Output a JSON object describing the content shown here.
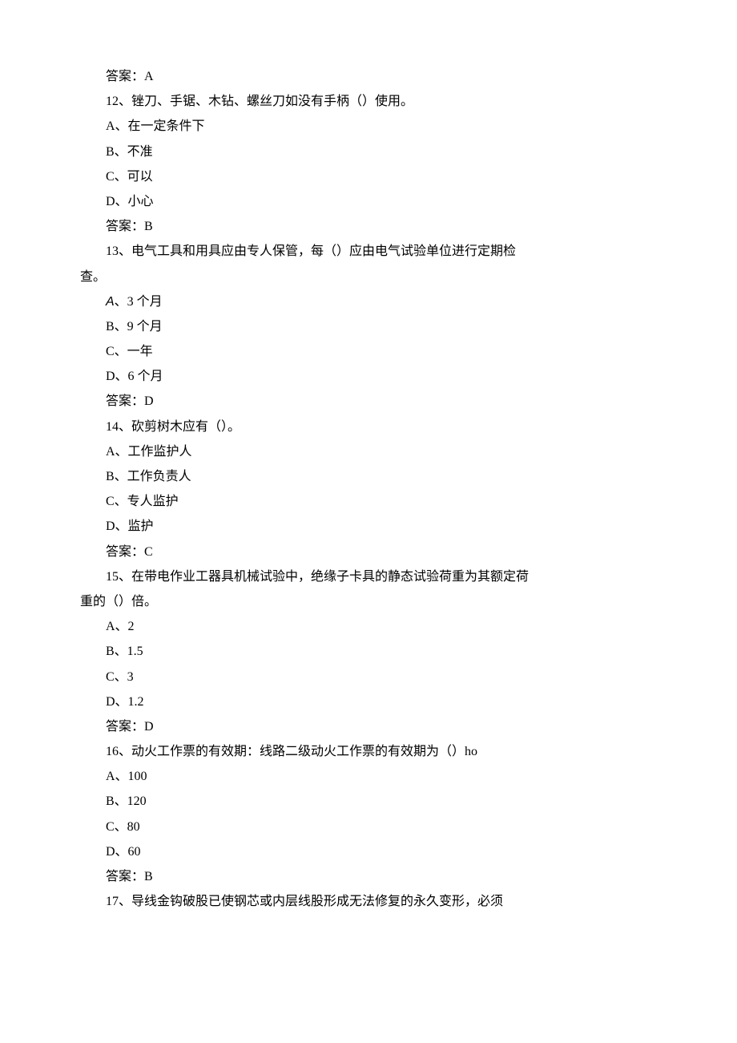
{
  "lines": [
    {
      "indent": true,
      "text": "答案：A"
    },
    {
      "indent": true,
      "text": "12、锉刀、手锯、木钻、螺丝刀如没有手柄（）使用。"
    },
    {
      "indent": true,
      "text": "A、在一定条件下"
    },
    {
      "indent": true,
      "text": "B、不准"
    },
    {
      "indent": true,
      "text": "C、可以"
    },
    {
      "indent": true,
      "text": "D、小心"
    },
    {
      "indent": true,
      "text": "答案：B"
    },
    {
      "indent": true,
      "text": "13、电气工具和用具应由专人保管，每（）应由电气试验单位进行定期检"
    },
    {
      "indent": false,
      "text": "查。"
    },
    {
      "indent": true,
      "italicA": true,
      "text": "、3 个月"
    },
    {
      "indent": true,
      "text": "B、9 个月"
    },
    {
      "indent": true,
      "text": "C、一年"
    },
    {
      "indent": true,
      "text": "D、6 个月"
    },
    {
      "indent": true,
      "text": "答案：D"
    },
    {
      "indent": true,
      "text": "14、砍剪树木应有（）。"
    },
    {
      "indent": true,
      "text": "A、工作监护人"
    },
    {
      "indent": true,
      "text": "B、工作负责人"
    },
    {
      "indent": true,
      "text": "C、专人监护"
    },
    {
      "indent": true,
      "text": "D、监护"
    },
    {
      "indent": true,
      "text": "答案：C"
    },
    {
      "indent": true,
      "text": "15、在带电作业工器具机械试验中，绝缘子卡具的静态试验荷重为其额定荷"
    },
    {
      "indent": false,
      "text": "重的（）倍。"
    },
    {
      "indent": true,
      "text": "A、2"
    },
    {
      "indent": true,
      "text": "B、1.5"
    },
    {
      "indent": true,
      "text": "C、3"
    },
    {
      "indent": true,
      "text": "D、1.2"
    },
    {
      "indent": true,
      "text": "答案：D"
    },
    {
      "indent": true,
      "text": "16、动火工作票的有效期：线路二级动火工作票的有效期为（）ho"
    },
    {
      "indent": true,
      "text": "A、100"
    },
    {
      "indent": true,
      "text": "B、120"
    },
    {
      "indent": true,
      "text": "C、80"
    },
    {
      "indent": true,
      "text": "D、60"
    },
    {
      "indent": true,
      "text": "答案：B"
    },
    {
      "indent": true,
      "text": "17、导线金钩破股已使钢芯或内层线股形成无法修复的永久变形，必须"
    }
  ]
}
